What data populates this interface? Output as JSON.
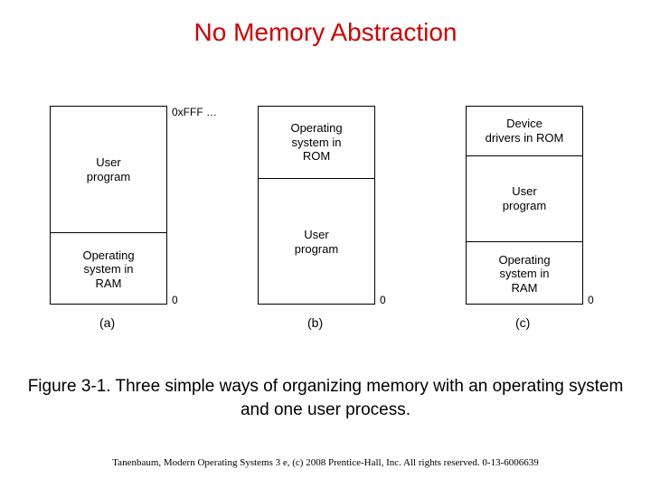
{
  "title": "No Memory Abstraction",
  "addr_top": "0xFFF …",
  "addr_zero_a": "0",
  "addr_zero_b": "0",
  "addr_zero_c": "0",
  "block_a": {
    "s1": "User\nprogram",
    "s2": "Operating\nsystem in\nRAM",
    "label": "(a)"
  },
  "block_b": {
    "s1": "Operating\nsystem in\nROM",
    "s2": "User\nprogram",
    "label": "(b)"
  },
  "block_c": {
    "s1": "Device\ndrivers in ROM",
    "s2": "User\nprogram",
    "s3": "Operating\nsystem in\nRAM",
    "label": "(c)"
  },
  "caption": "Figure 3-1. Three simple ways of organizing memory with an operating system and one user process.",
  "footer": "Tanenbaum, Modern Operating Systems 3 e, (c) 2008 Prentice-Hall, Inc. All rights reserved. 0-13-6006639"
}
